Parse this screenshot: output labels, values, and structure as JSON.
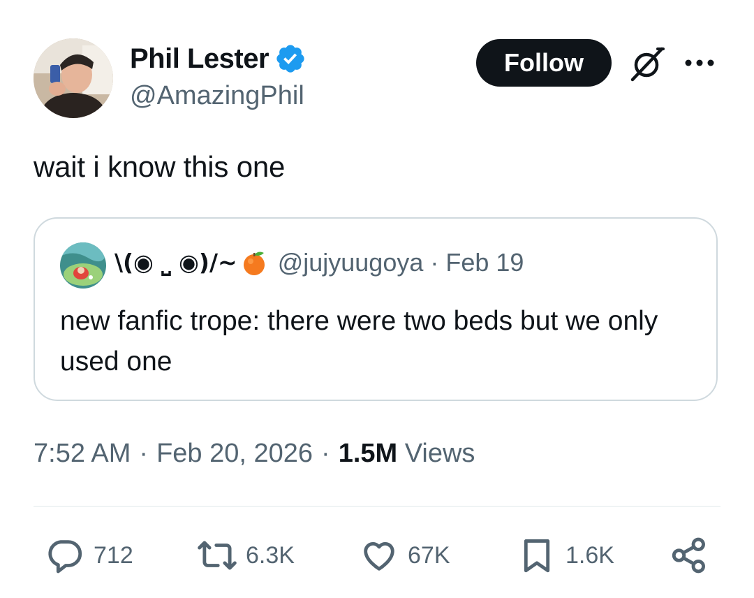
{
  "author": {
    "name": "Phil Lester",
    "handle": "@AmazingPhil",
    "verified": true
  },
  "header": {
    "follow_label": "Follow"
  },
  "tweet": {
    "text": "wait i know this one"
  },
  "quote": {
    "name": "\\(◉ ⎵ ◉)/~",
    "emoji": "tangerine",
    "handle": "@jujyuugoya",
    "separator": "·",
    "date": "Feb 19",
    "text": "new fanfic trope: there were two beds but we only used one"
  },
  "meta": {
    "time": "7:52 AM",
    "separator": "·",
    "date": "Feb 20, 2026",
    "views_count": "1.5M",
    "views_label": "Views"
  },
  "actions": {
    "replies": "712",
    "reposts": "6.3K",
    "likes": "67K",
    "bookmarks": "1.6K"
  },
  "colors": {
    "text_primary": "#0f1419",
    "text_secondary": "#536471",
    "verified_blue": "#1d9bf0",
    "border": "#cfd9de"
  },
  "icons": {
    "verified": "verified-badge-icon",
    "grok": "grok-icon",
    "more": "more-dots-icon",
    "reply": "reply-icon",
    "repost": "repost-icon",
    "like": "heart-icon",
    "bookmark": "bookmark-icon",
    "share": "share-icon"
  }
}
